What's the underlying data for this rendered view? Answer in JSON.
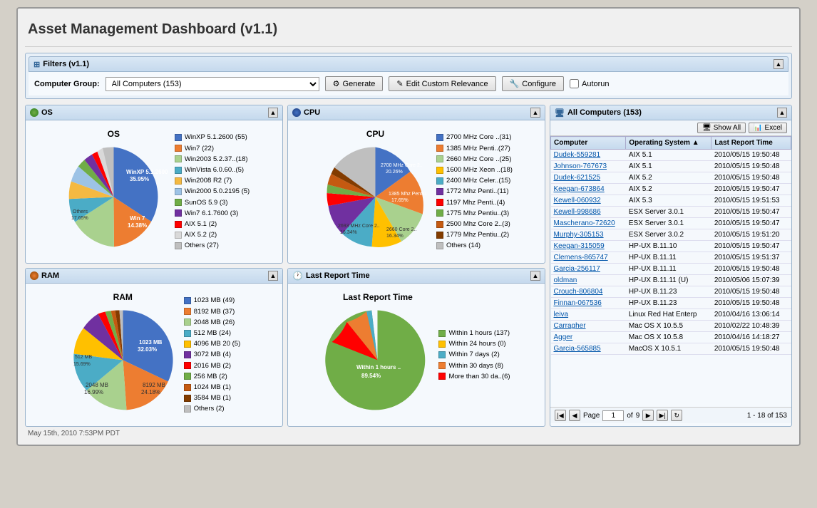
{
  "app": {
    "title": "Asset Management Dashboard (v1.1)"
  },
  "filters": {
    "header": "Filters (v1.1)",
    "computer_group_label": "Computer Group:",
    "computer_group_value": "All Computers (153)",
    "generate_label": "Generate",
    "edit_relevance_label": "Edit Custom Relevance",
    "configure_label": "Configure",
    "autorun_label": "Autorun"
  },
  "os_panel": {
    "title": "OS",
    "chart_title": "OS",
    "legend": [
      {
        "label": "WinXP 5.1.2600 (55)",
        "color": "#4472c4"
      },
      {
        "label": "Win7 (22)",
        "color": "#ed7d31"
      },
      {
        "label": "Win2003 5.2.37..(18)",
        "color": "#a9d18e"
      },
      {
        "label": "WinVista 6.0.60..(5)",
        "color": "#4bacc6"
      },
      {
        "label": "Win2008 R2 (7)",
        "color": "#f4b942"
      },
      {
        "label": "Win2000 5.0.2195 (5)",
        "color": "#9dc3e6"
      },
      {
        "label": "SunOS 5.9 (3)",
        "color": "#70ad47"
      },
      {
        "label": "Win7 6.1.7600 (3)",
        "color": "#7030a0"
      },
      {
        "label": "AIX 5.1 (2)",
        "color": "#ff0000"
      },
      {
        "label": "AIX 5.2 (2)",
        "color": "#d9d9d9"
      },
      {
        "label": "Others (27)",
        "color": "#bfbfbf"
      }
    ],
    "slices": [
      {
        "label": "WinXP",
        "percent": 35.95,
        "color": "#4472c4",
        "text": "WinXP 5.1.2600\n35.95%"
      },
      {
        "label": "Win7",
        "percent": 14.38,
        "color": "#ed7d31",
        "text": "Win 7\n14.38%"
      },
      {
        "label": "Win2003",
        "percent": 11.76,
        "color": "#a9d18e",
        "text": ""
      },
      {
        "label": "WinVista",
        "percent": 3.27,
        "color": "#4bacc6",
        "text": ""
      },
      {
        "label": "Win2008R2",
        "percent": 4.58,
        "color": "#f4b942",
        "text": ""
      },
      {
        "label": "Win2000",
        "percent": 3.27,
        "color": "#9dc3e6",
        "text": ""
      },
      {
        "label": "SunOS",
        "percent": 1.96,
        "color": "#70ad47",
        "text": ""
      },
      {
        "label": "Win76",
        "percent": 1.96,
        "color": "#7030a0",
        "text": ""
      },
      {
        "label": "AIX51",
        "percent": 1.31,
        "color": "#ff0000",
        "text": ""
      },
      {
        "label": "AIX52",
        "percent": 1.31,
        "color": "#d9d9d9",
        "text": ""
      },
      {
        "label": "Others",
        "percent": 17.65,
        "color": "#bfbfbf",
        "text": "Others\n17.65%"
      }
    ]
  },
  "cpu_panel": {
    "title": "CPU",
    "chart_title": "CPU",
    "legend": [
      {
        "label": "2700 MHz Core ..(31)",
        "color": "#4472c4"
      },
      {
        "label": "1385 MHz Penti..(27)",
        "color": "#ed7d31"
      },
      {
        "label": "2660 MHz Core ..(25)",
        "color": "#a9d18e"
      },
      {
        "label": "1600 MHz Xeon ..(18)",
        "color": "#ffc000"
      },
      {
        "label": "2400 MHz Celer..(15)",
        "color": "#4bacc6"
      },
      {
        "label": "1772 Mhz Penti..(11)",
        "color": "#7030a0"
      },
      {
        "label": "1197 Mhz Penti..(4)",
        "color": "#ff0000"
      },
      {
        "label": "1775 Mhz Pentiu..(3)",
        "color": "#70ad47"
      },
      {
        "label": "2500 Mhz Core 2..(3)",
        "color": "#c55a11"
      },
      {
        "label": "1779 Mhz Pentiu..(2)",
        "color": "#833c00"
      },
      {
        "label": "Others (14)",
        "color": "#bfbfbf"
      }
    ],
    "slices": [
      {
        "label": "2700 Core",
        "percent": 20.26,
        "color": "#4472c4"
      },
      {
        "label": "1385 Penti",
        "percent": 17.65,
        "color": "#ed7d31"
      },
      {
        "label": "2660 Core",
        "percent": 16.34,
        "color": "#a9d18e"
      },
      {
        "label": "1600 Xeon",
        "percent": 11.76,
        "color": "#ffc000"
      },
      {
        "label": "2400 Celer",
        "percent": 9.8,
        "color": "#4bacc6"
      },
      {
        "label": "1772 Penti",
        "percent": 7.19,
        "color": "#7030a0"
      },
      {
        "label": "1197 Penti",
        "percent": 2.61,
        "color": "#ff0000"
      },
      {
        "label": "1775 Penti",
        "percent": 1.96,
        "color": "#70ad47"
      },
      {
        "label": "2500 Core2",
        "percent": 1.96,
        "color": "#c55a11"
      },
      {
        "label": "1779 Penti",
        "percent": 1.31,
        "color": "#833c00"
      },
      {
        "label": "Others",
        "percent": 9.15,
        "color": "#bfbfbf"
      }
    ]
  },
  "ram_panel": {
    "title": "RAM",
    "chart_title": "RAM",
    "legend": [
      {
        "label": "1023 MB (49)",
        "color": "#4472c4"
      },
      {
        "label": "8192 MB (37)",
        "color": "#ed7d31"
      },
      {
        "label": "2048 MB (26)",
        "color": "#a9d18e"
      },
      {
        "label": "512 MB (24)",
        "color": "#4bacc6"
      },
      {
        "label": "4096 MB 20 (5)",
        "color": "#ffc000"
      },
      {
        "label": "3072 MB (4)",
        "color": "#7030a0"
      },
      {
        "label": "2016 MB (2)",
        "color": "#ff0000"
      },
      {
        "label": "256 MB (2)",
        "color": "#70ad47"
      },
      {
        "label": "1024 MB (1)",
        "color": "#c55a11"
      },
      {
        "label": "3584 MB (1)",
        "color": "#833c00"
      },
      {
        "label": "Others (2)",
        "color": "#bfbfbf"
      }
    ],
    "slices": [
      {
        "label": "1023 MB",
        "percent": 32.03,
        "color": "#4472c4"
      },
      {
        "label": "8192 MB",
        "percent": 24.18,
        "color": "#ed7d31"
      },
      {
        "label": "2048 MB",
        "percent": 16.99,
        "color": "#a9d18e"
      },
      {
        "label": "512 MB",
        "percent": 15.69,
        "color": "#4bacc6"
      },
      {
        "label": "4096 MB",
        "percent": 13.07,
        "color": "#ffc000"
      },
      {
        "label": "3072 MB",
        "percent": 2.61,
        "color": "#7030a0"
      },
      {
        "label": "2016 MB",
        "percent": 1.31,
        "color": "#ff0000"
      },
      {
        "label": "256 MB",
        "percent": 1.31,
        "color": "#70ad47"
      },
      {
        "label": "1024 MB",
        "percent": 0.65,
        "color": "#c55a11"
      },
      {
        "label": "3584 MB",
        "percent": 0.65,
        "color": "#833c00"
      },
      {
        "label": "Others",
        "percent": 1.31,
        "color": "#bfbfbf"
      }
    ]
  },
  "last_report_panel": {
    "title": "Last Report Time",
    "chart_title": "Last Report Time",
    "legend": [
      {
        "label": "Within 1 hours (137)",
        "color": "#70ad47"
      },
      {
        "label": "Within 24 hours (0)",
        "color": "#ffc000"
      },
      {
        "label": "Within 7 days (2)",
        "color": "#4bacc6"
      },
      {
        "label": "Within 30 days (8)",
        "color": "#ed7d31"
      },
      {
        "label": "More than 30 da..(6)",
        "color": "#ff0000"
      }
    ],
    "slices": [
      {
        "label": "Within 1 hours",
        "percent": 89.54,
        "color": "#70ad47"
      },
      {
        "label": "Within 7 days",
        "percent": 1.31,
        "color": "#4bacc6"
      },
      {
        "label": "Within 30 days",
        "percent": 5.23,
        "color": "#ed7d31"
      },
      {
        "label": "More than 30",
        "percent": 3.92,
        "color": "#ff0000"
      }
    ],
    "center_label": "Within 1 hours ..\n89.54%"
  },
  "all_computers": {
    "title": "All Computers (153)",
    "show_all_label": "Show All",
    "excel_label": "Excel",
    "columns": [
      "Computer",
      "Operating System",
      "Last Report Time"
    ],
    "rows": [
      {
        "computer": "Dudek-559281",
        "os": "AIX 5.1",
        "time": "2010/05/15 19:50:48"
      },
      {
        "computer": "Johnson-767673",
        "os": "AIX 5.1",
        "time": "2010/05/15 19:50:48"
      },
      {
        "computer": "Dudek-621525",
        "os": "AIX 5.2",
        "time": "2010/05/15 19:50:48"
      },
      {
        "computer": "Keegan-673864",
        "os": "AIX 5.2",
        "time": "2010/05/15 19:50:47"
      },
      {
        "computer": "Kewell-060932",
        "os": "AIX 5.3",
        "time": "2010/05/15 19:51:53"
      },
      {
        "computer": "Kewell-998686",
        "os": "ESX Server 3.0.1",
        "time": "2010/05/15 19:50:47"
      },
      {
        "computer": "Mascherano-72620",
        "os": "ESX Server 3.0.1",
        "time": "2010/05/15 19:50:47"
      },
      {
        "computer": "Murphy-305153",
        "os": "ESX Server 3.0.2",
        "time": "2010/05/15 19:51:20"
      },
      {
        "computer": "Keegan-315059",
        "os": "HP-UX B.11.10",
        "time": "2010/05/15 19:50:47"
      },
      {
        "computer": "Clemens-865747",
        "os": "HP-UX B.11.11",
        "time": "2010/05/15 19:51:37"
      },
      {
        "computer": "Garcia-256117",
        "os": "HP-UX B.11.11",
        "time": "2010/05/15 19:50:48"
      },
      {
        "computer": "oldman",
        "os": "HP-UX B.11.11 (U)",
        "time": "2010/05/06 15:07:39"
      },
      {
        "computer": "Crouch-806804",
        "os": "HP-UX B.11.23",
        "time": "2010/05/15 19:50:48"
      },
      {
        "computer": "Finnan-067536",
        "os": "HP-UX B.11.23",
        "time": "2010/05/15 19:50:48"
      },
      {
        "computer": "leiva",
        "os": "Linux Red Hat Enterp",
        "time": "2010/04/16 13:06:14"
      },
      {
        "computer": "Carragher",
        "os": "Mac OS X 10.5.5",
        "time": "2010/02/22 10:48:39"
      },
      {
        "computer": "Agger",
        "os": "Mac OS X 10.5.8",
        "time": "2010/04/16 14:18:27"
      },
      {
        "computer": "Garcia-565885",
        "os": "MacOS X 10.5.1",
        "time": "2010/05/15 19:50:48"
      }
    ],
    "pagination": {
      "current_page": "1",
      "total_pages": "9",
      "range_label": "1 - 18 of 153"
    }
  },
  "status_bar": {
    "text": "May 15th, 2010 7:53PM PDT"
  }
}
